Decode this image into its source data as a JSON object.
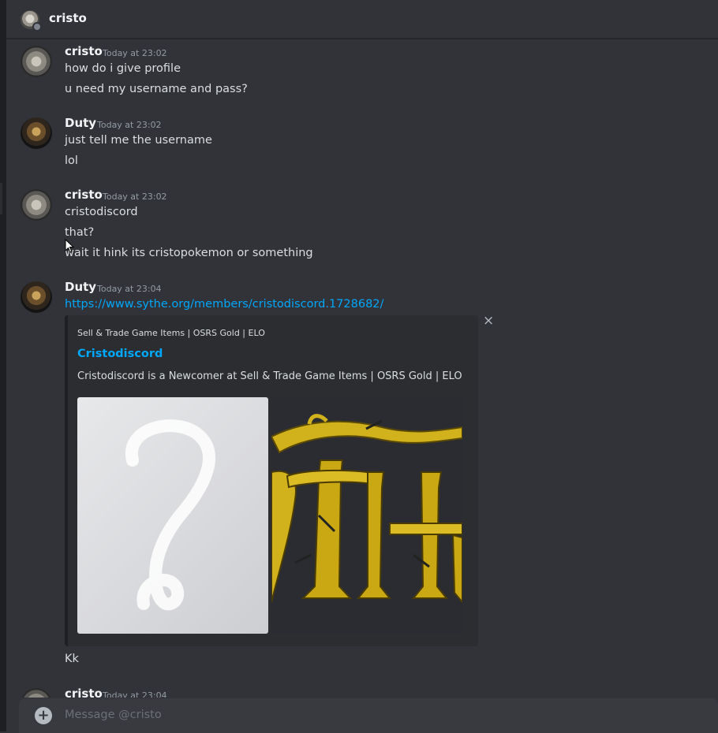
{
  "header": {
    "title": "cristo"
  },
  "messages": [
    {
      "author": "cristo",
      "timestamp": "Today at 23:02",
      "lines": [
        "how do i give profile",
        "u need my username and pass?"
      ]
    },
    {
      "author": "Duty",
      "timestamp": "Today at 23:02",
      "lines": [
        "just tell me the username",
        "lol"
      ]
    },
    {
      "author": "cristo",
      "timestamp": "Today at 23:02",
      "lines": [
        "cristodiscord",
        "that?",
        "wait it hink its cristopokemon or something"
      ]
    },
    {
      "author": "Duty",
      "timestamp": "Today at 23:04",
      "link": "https://www.sythe.org/members/cristodiscord.1728682/",
      "after": "Kk"
    },
    {
      "author": "cristo",
      "timestamp": "Today at 23:04"
    }
  ],
  "embed": {
    "provider": "Sell & Trade Game Items | OSRS Gold | ELO",
    "title": "Cristodiscord",
    "description": "Cristodiscord is a Newcomer at Sell & Trade Game Items | OSRS Gold | ELO",
    "close_icon": "×"
  },
  "composer": {
    "placeholder": "Message @cristo",
    "plus_icon": "+"
  }
}
